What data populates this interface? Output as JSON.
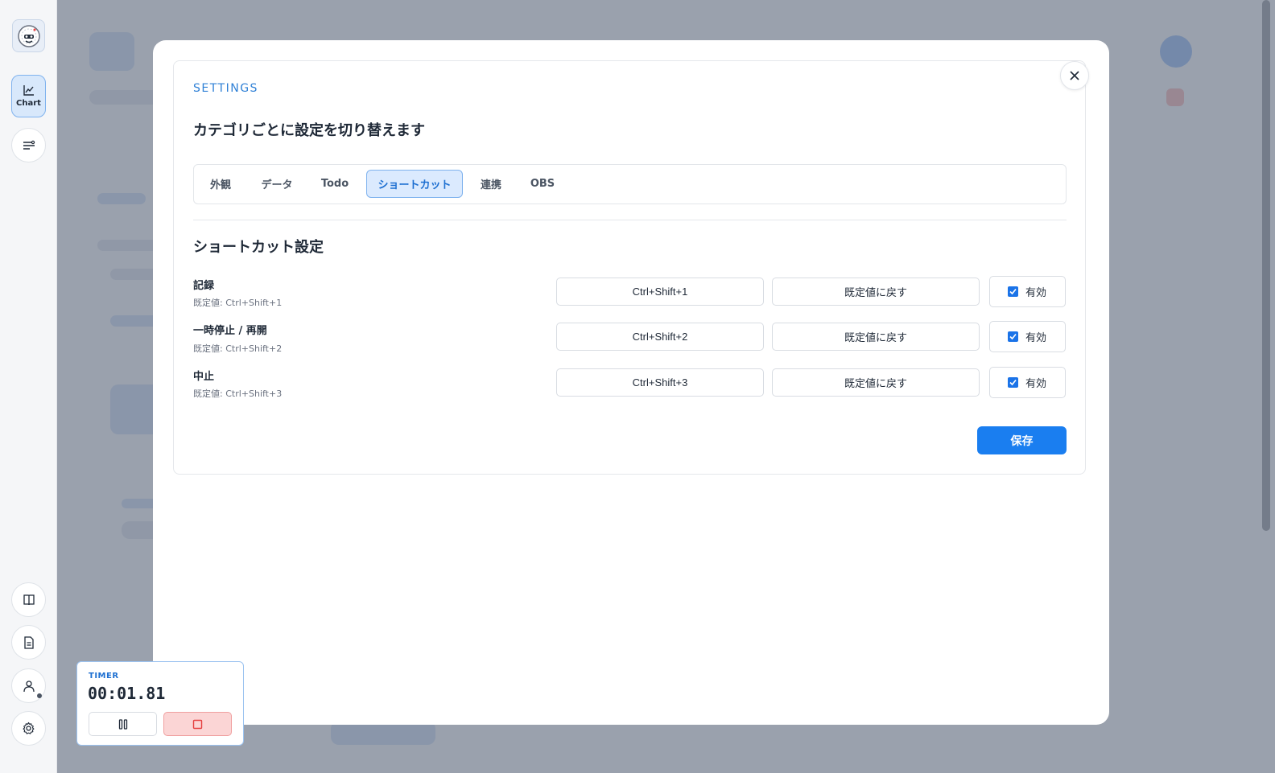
{
  "sidebar": {
    "items": [
      {
        "name": "logo",
        "icon": "mascot-logo-icon"
      },
      {
        "name": "chart",
        "label": "Chart",
        "icon": "line-chart-icon",
        "active": true
      },
      {
        "name": "filters",
        "icon": "sliders-icon"
      },
      {
        "name": "book",
        "icon": "book-icon"
      },
      {
        "name": "document",
        "icon": "document-icon"
      },
      {
        "name": "user",
        "icon": "user-icon"
      },
      {
        "name": "settings",
        "icon": "gear-icon"
      }
    ]
  },
  "settings": {
    "eyebrow": "SETTINGS",
    "subtitle": "カテゴリごとに設定を切り替えます",
    "tabs": [
      {
        "label": "外観",
        "active": false
      },
      {
        "label": "データ",
        "active": false
      },
      {
        "label": "Todo",
        "active": false
      },
      {
        "label": "ショートカット",
        "active": true
      },
      {
        "label": "連携",
        "active": false
      },
      {
        "label": "OBS",
        "active": false
      }
    ],
    "section_title": "ショートカット設定",
    "shortcuts": [
      {
        "label": "記録",
        "default": "既定値: Ctrl+Shift+1",
        "value": "Ctrl+Shift+1",
        "reset_label": "既定値に戻す",
        "enabled_label": "有効",
        "enabled": true
      },
      {
        "label": "一時停止 / 再開",
        "default": "既定値: Ctrl+Shift+2",
        "value": "Ctrl+Shift+2",
        "reset_label": "既定値に戻す",
        "enabled_label": "有効",
        "enabled": true
      },
      {
        "label": "中止",
        "default": "既定値: Ctrl+Shift+3",
        "value": "Ctrl+Shift+3",
        "reset_label": "既定値に戻す",
        "enabled_label": "有効",
        "enabled": true
      }
    ],
    "save_label": "保存"
  },
  "timer": {
    "label": "TIMER",
    "time": "00:01.81"
  },
  "colors": {
    "accent": "#1a7ef0",
    "active_tab_bg": "#dbeafe",
    "stop_bg": "#fbd5d5"
  }
}
